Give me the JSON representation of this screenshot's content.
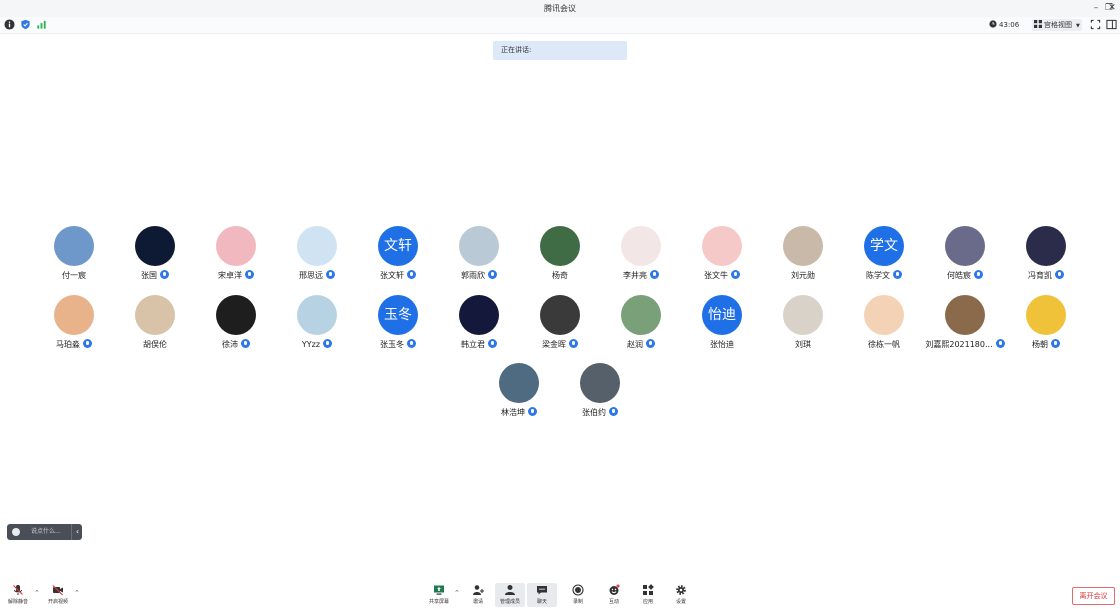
{
  "window": {
    "title": "腾讯会议"
  },
  "topbar": {
    "timer": "43:06",
    "view_mode": "宫格视图"
  },
  "speaking": {
    "label": "正在讲话:"
  },
  "participants": [
    {
      "name": "付一宸",
      "avatar_text": "",
      "mic": false
    },
    {
      "name": "张国",
      "avatar_text": "",
      "mic": true
    },
    {
      "name": "宋卓洋",
      "avatar_text": "",
      "mic": true
    },
    {
      "name": "邢思远",
      "avatar_text": "",
      "mic": true
    },
    {
      "name": "张文轩",
      "avatar_text": "文轩",
      "mic": true
    },
    {
      "name": "郭雨欣",
      "avatar_text": "",
      "mic": true
    },
    {
      "name": "杨奇",
      "avatar_text": "",
      "mic": false
    },
    {
      "name": "李井亮",
      "avatar_text": "",
      "mic": true
    },
    {
      "name": "张文牛",
      "avatar_text": "",
      "mic": true
    },
    {
      "name": "刘元勋",
      "avatar_text": "",
      "mic": false
    },
    {
      "name": "陈学文",
      "avatar_text": "学文",
      "mic": true
    },
    {
      "name": "何皓宸",
      "avatar_text": "",
      "mic": true
    },
    {
      "name": "冯育凯",
      "avatar_text": "",
      "mic": true
    },
    {
      "name": "马珀淼",
      "avatar_text": "",
      "mic": true
    },
    {
      "name": "胡俣伦",
      "avatar_text": "",
      "mic": false
    },
    {
      "name": "徐沛",
      "avatar_text": "",
      "mic": true
    },
    {
      "name": "YYzz",
      "avatar_text": "",
      "mic": true
    },
    {
      "name": "张玉冬",
      "avatar_text": "玉冬",
      "mic": true
    },
    {
      "name": "韩立君",
      "avatar_text": "",
      "mic": true
    },
    {
      "name": "梁金晖",
      "avatar_text": "",
      "mic": true
    },
    {
      "name": "赵润",
      "avatar_text": "",
      "mic": true
    },
    {
      "name": "张怡迪",
      "avatar_text": "怡迪",
      "mic": false
    },
    {
      "name": "刘琪",
      "avatar_text": "",
      "mic": false
    },
    {
      "name": "徐栋一帆",
      "avatar_text": "",
      "mic": false
    },
    {
      "name": "刘嘉熙2021180...",
      "avatar_text": "",
      "mic": true
    },
    {
      "name": "杨朝",
      "avatar_text": "",
      "mic": true
    },
    {
      "name": "林浩坤",
      "avatar_text": "",
      "mic": true
    },
    {
      "name": "张伯约",
      "avatar_text": "",
      "mic": true
    }
  ],
  "chat": {
    "placeholder": "说点什么..."
  },
  "toolbar": {
    "unmute": "解除静音",
    "video": "开启视频",
    "share": "共享屏幕",
    "invite": "邀请",
    "members": "管理成员",
    "chat": "聊天",
    "record": "录制",
    "reactions": "互动",
    "apps": "应用",
    "settings": "设置",
    "leave": "离开会议"
  },
  "colors": {
    "accent": "#1f6fe6",
    "leave": "#d33333"
  }
}
